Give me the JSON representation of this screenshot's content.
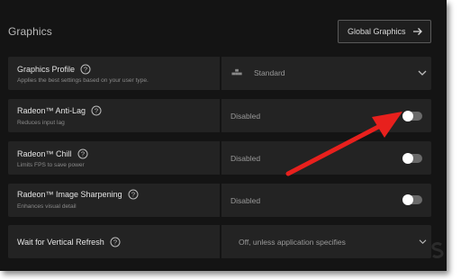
{
  "header": {
    "title": "Graphics",
    "global_button_label": "Global Graphics"
  },
  "rows": [
    {
      "title": "Graphics Profile",
      "subtitle": "Applies the best settings based on your user type.",
      "value": "Standard",
      "control": "dropdown"
    },
    {
      "title": "Radeon™ Anti-Lag",
      "subtitle": "Reduces input lag",
      "value": "Disabled",
      "control": "toggle",
      "on": false
    },
    {
      "title": "Radeon™ Chill",
      "subtitle": "Limits FPS to save power",
      "value": "Disabled",
      "control": "toggle",
      "on": false
    },
    {
      "title": "Radeon™ Image Sharpening",
      "subtitle": "Enhances visual detail",
      "value": "Disabled",
      "control": "toggle",
      "on": false
    },
    {
      "title": "Wait for Vertical Refresh",
      "value": "Off, unless application specifies",
      "control": "dropdown"
    }
  ],
  "icons": {
    "help": "question-circle-icon",
    "profile": "gamepad-icon",
    "dropdown": "chevron-down-icon",
    "global_button": "arrow-right-icon",
    "annotation": "red-arrow-annotation"
  },
  "colors": {
    "background": "#141414",
    "row": "#232323",
    "annotation_arrow": "#e8201d"
  }
}
